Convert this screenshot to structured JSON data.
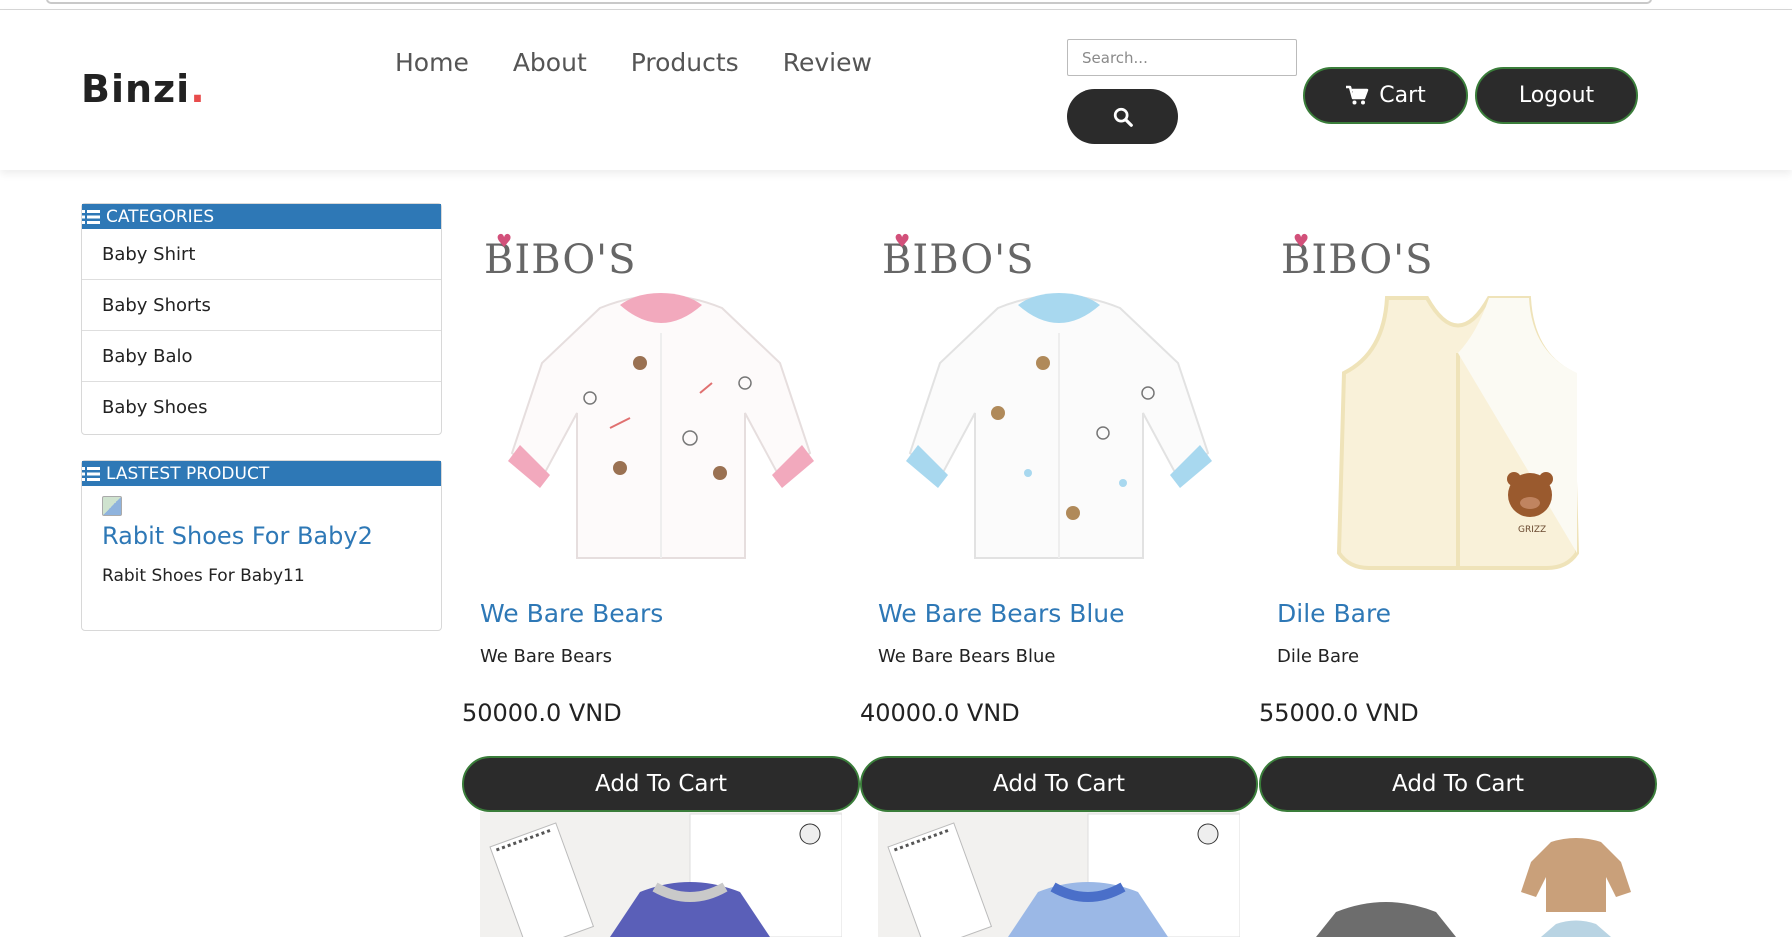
{
  "header": {
    "logo_text": "Binzi",
    "logo_dot": ".",
    "nav": [
      {
        "label": "Home"
      },
      {
        "label": "About"
      },
      {
        "label": "Products"
      },
      {
        "label": "Review"
      }
    ],
    "search": {
      "placeholder": "Search...",
      "icon": "search-icon"
    },
    "cart_label": "Cart",
    "cart_icon": "shopping-cart-icon",
    "logout_label": "Logout"
  },
  "sidebar": {
    "categories_title": "CATEGORIES",
    "categories": [
      {
        "label": "Baby Shirt"
      },
      {
        "label": "Baby Shorts"
      },
      {
        "label": "Baby Balo"
      },
      {
        "label": "Baby Shoes"
      }
    ],
    "latest_title": "LASTEST PRODUCT",
    "latest_product": {
      "title": "Rabit Shoes For Baby2",
      "description": "Rabit Shoes For Baby11"
    }
  },
  "products": [
    {
      "brand": "BIBO'S",
      "title": "We Bare Bears",
      "description": "We Bare Bears",
      "price": "50000.0 VND",
      "button": "Add To Cart",
      "accent": "#f2a9bd"
    },
    {
      "brand": "BIBO'S",
      "title": "We Bare Bears Blue",
      "description": "We Bare Bears Blue",
      "price": "40000.0 VND",
      "button": "Add To Cart",
      "accent": "#a8d8ef"
    },
    {
      "brand": "BIBO'S",
      "title": "Dile Bare",
      "description": "Dile Bare",
      "price": "55000.0 VND",
      "button": "Add To Cart",
      "accent": "#f6ecc8",
      "bear_label": "GRIZZ"
    }
  ],
  "colors": {
    "primary_blue": "#2e78b6",
    "dark_button": "#2b2b2b",
    "logo_accent": "#e84c4c"
  }
}
